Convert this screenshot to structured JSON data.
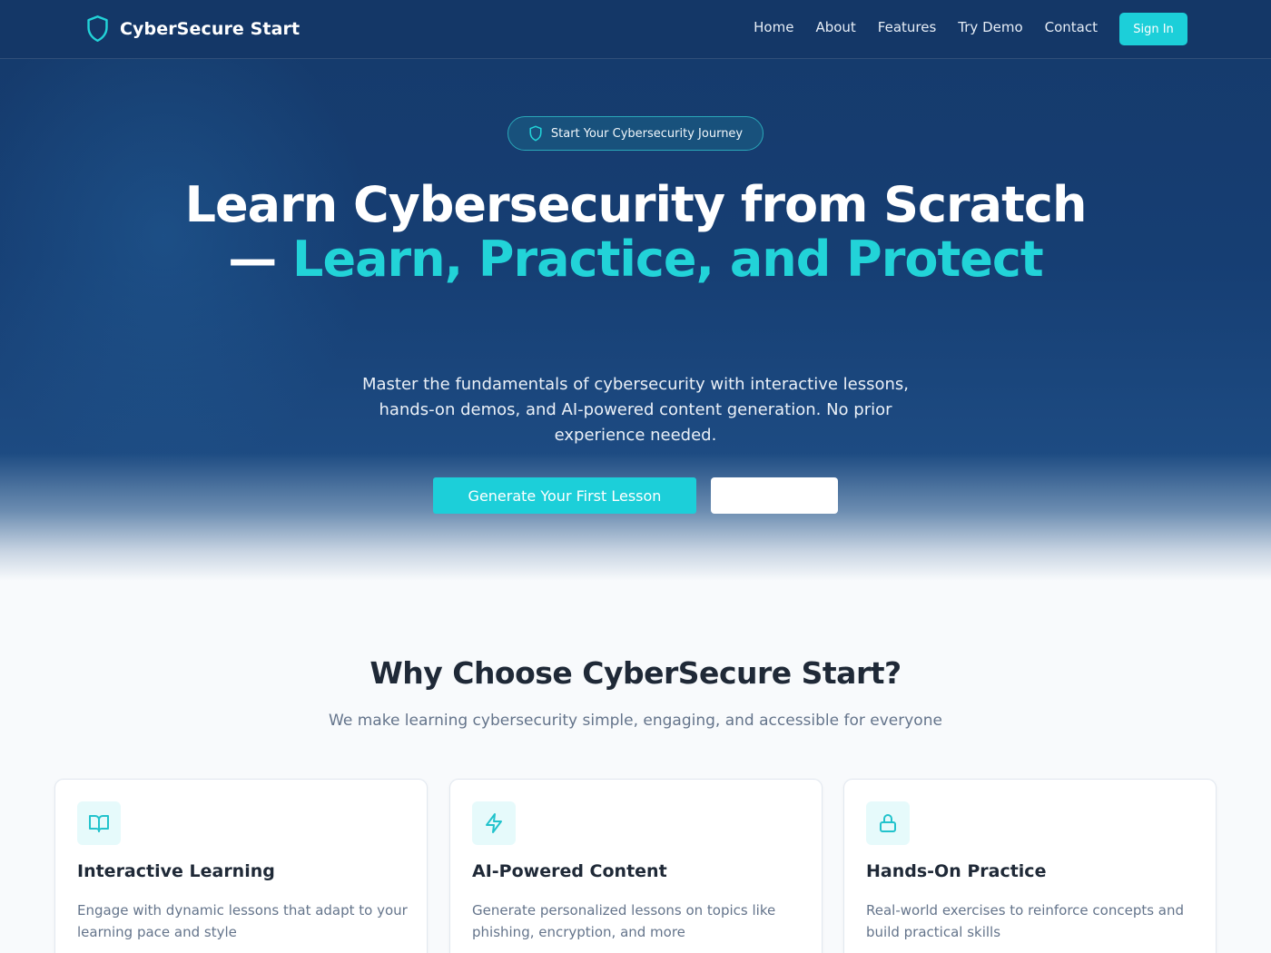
{
  "nav": {
    "brand": "CyberSecure Start",
    "links": [
      "Home",
      "About",
      "Features",
      "Try Demo",
      "Contact"
    ],
    "signin_label": "Sign In"
  },
  "hero": {
    "badge": "Start Your Cybersecurity Journey",
    "title_plain": "Learn Cybersecurity from Scratch — ",
    "title_accent": "Learn, Practice, and Protect",
    "subtitle": "Master the fundamentals of cybersecurity with interactive lessons, hands-on demos, and AI-powered content generation. No prior experience needed.",
    "cta_primary": "Generate Your First Lesson",
    "cta_secondary": ""
  },
  "why": {
    "title": "Why Choose CyberSecure Start?",
    "subtitle": "We make learning cybersecurity simple, engaging, and accessible for everyone"
  },
  "features": [
    {
      "icon": "book-open-icon",
      "title": "Interactive Learning",
      "text": "Engage with dynamic lessons that adapt to your learning pace and style"
    },
    {
      "icon": "lightning-icon",
      "title": "AI-Powered Content",
      "text": "Generate personalized lessons on topics like phishing, encryption, and more"
    },
    {
      "icon": "lock-icon",
      "title": "Hands-On Practice",
      "text": "Real-world exercises to reinforce concepts and build practical skills"
    }
  ],
  "colors": {
    "accent": "#1ccfd9",
    "hero_navy": "#153a6b",
    "icon_bg": "#e6fafb"
  }
}
